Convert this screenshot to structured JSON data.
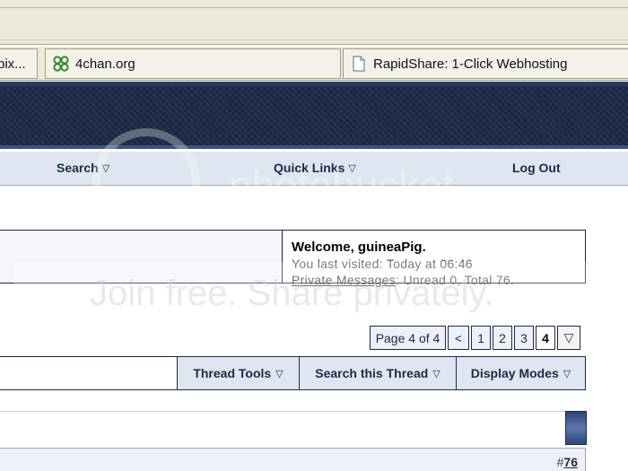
{
  "browser": {
    "tabs": [
      {
        "label": "pix...",
        "icon": "partial-tab-icon"
      },
      {
        "label": "4chan.org",
        "icon": "clover-icon"
      },
      {
        "label": "RapidShare: 1-Click Webhosting",
        "icon": "page-icon"
      }
    ]
  },
  "forum": {
    "nav": {
      "search": "Search",
      "quick_links": "Quick Links",
      "log_out": "Log Out"
    },
    "welcome": {
      "title": "Welcome, guineaPig.",
      "last_visited_prefix": "You last visited: ",
      "last_visited_value": "Today at 06:46",
      "private_messages_link": "Private Messages",
      "pm_status": ": Unread 0, Total 76."
    },
    "pagination": {
      "label": "Page 4 of 4",
      "prev": "<",
      "pages": [
        "1",
        "2",
        "3",
        "4"
      ],
      "current": "4",
      "current_page_fraction": 1.0,
      "menu_glyph": "▽"
    },
    "thread_tools": {
      "tools": "Thread Tools",
      "search_thread": "Search this Thread",
      "display_modes": "Display Modes",
      "dropdown_glyph": "▽"
    },
    "post": {
      "number_prefix": "#",
      "number": "76"
    }
  },
  "watermark": {
    "logo_text": "photobucket",
    "tagline": "Join free. Share privately."
  },
  "colors": {
    "banner": "#1d2a49",
    "navbar": "#dfe6f1",
    "border": "#1c2a4a",
    "chrome": "#ece9d8"
  }
}
